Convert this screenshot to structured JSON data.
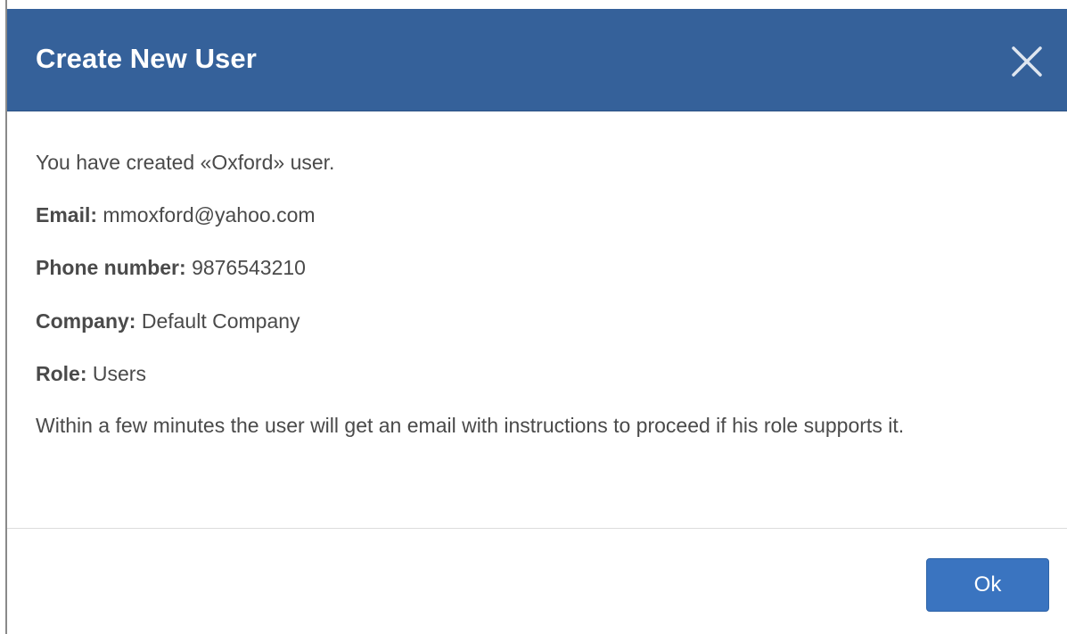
{
  "dialog": {
    "title": "Create New User",
    "close_icon": "close-icon",
    "message": "You have created «Oxford» user.",
    "fields": [
      {
        "label": "Email:",
        "value": "mmoxford@yahoo.com"
      },
      {
        "label": "Phone number:",
        "value": "9876543210"
      },
      {
        "label": "Company:",
        "value": "Default Company"
      },
      {
        "label": "Role:",
        "value": "Users"
      }
    ],
    "note": "Within a few minutes the user will get an email with instructions to proceed if his role supports it.",
    "ok_label": "Ok"
  },
  "colors": {
    "header": "#35619a",
    "button": "#3a74c0",
    "text": "#4a4a4a"
  }
}
